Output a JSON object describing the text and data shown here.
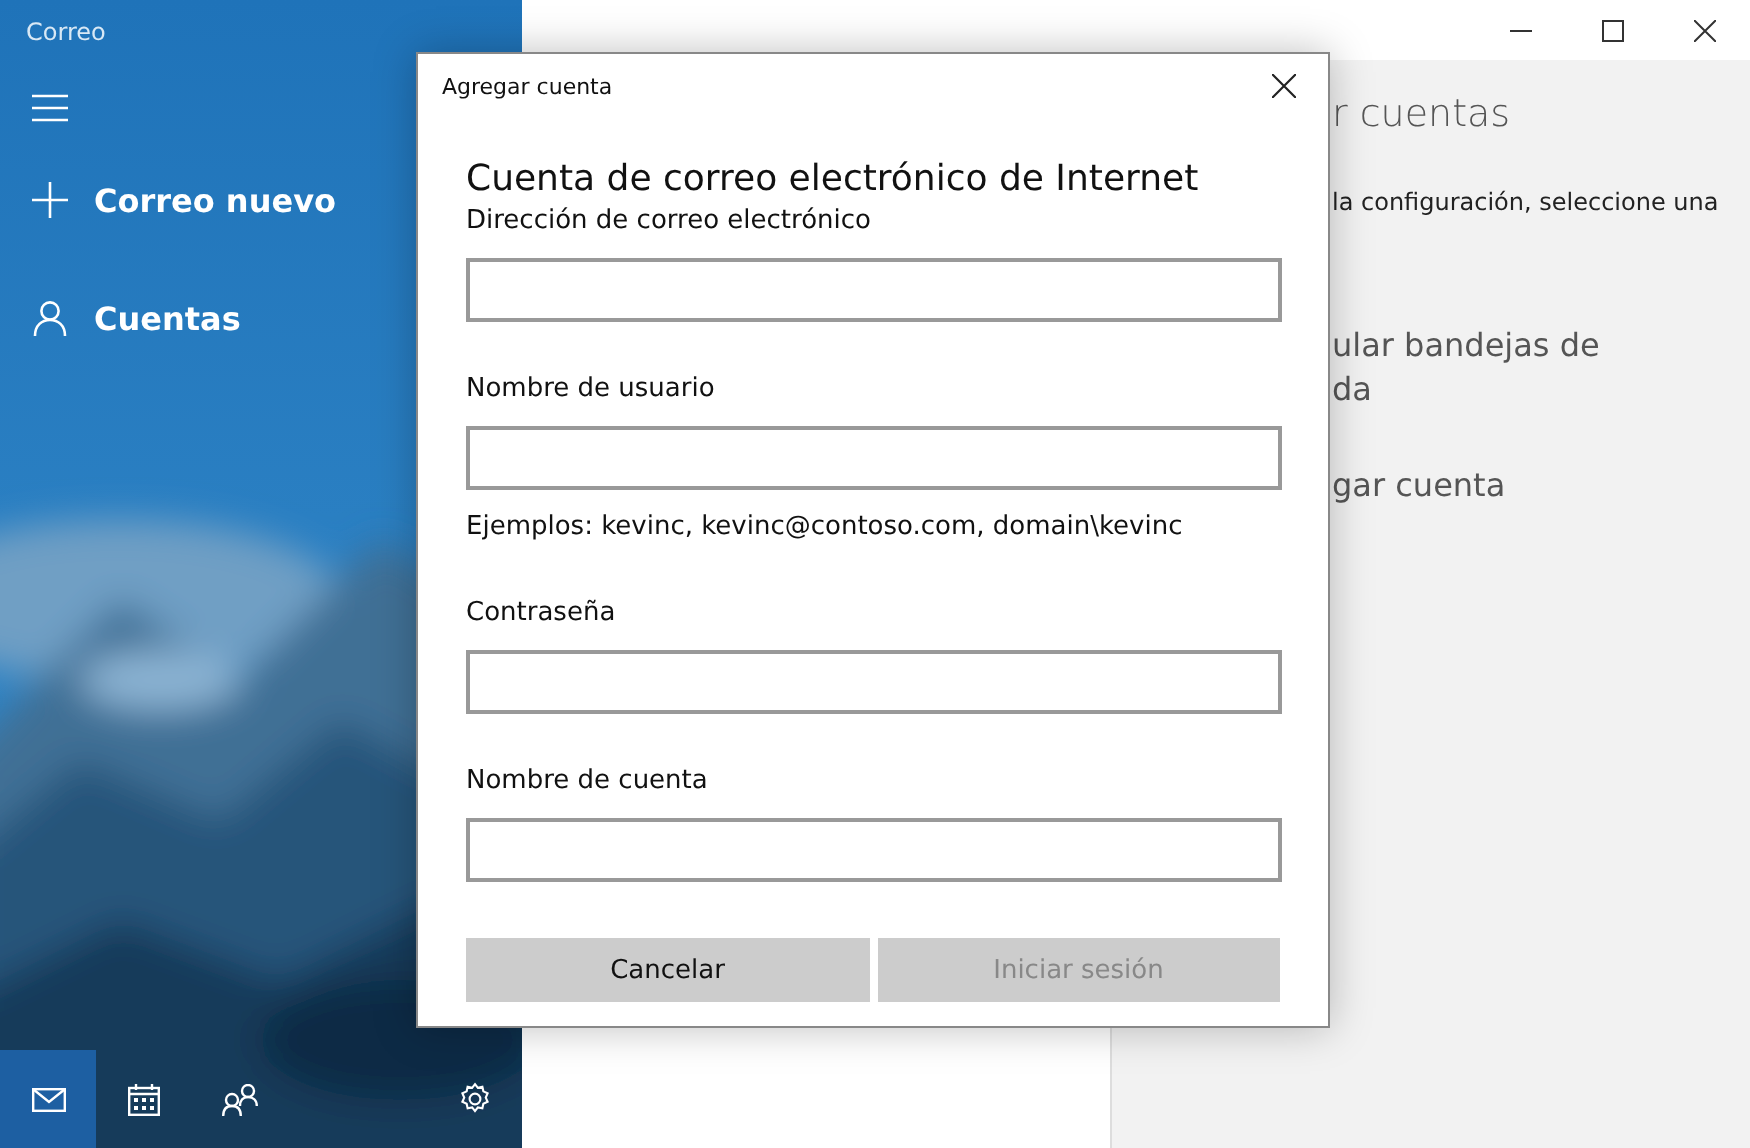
{
  "app": {
    "title": "Correo"
  },
  "nav": [
    {
      "kind": "new",
      "label": "Correo nuevo"
    },
    {
      "kind": "accounts",
      "label": "Cuentas"
    }
  ],
  "bottom_bar": [
    {
      "kind": "mail",
      "selected": true
    },
    {
      "kind": "calendar",
      "selected": false
    },
    {
      "kind": "people",
      "selected": false
    },
    {
      "kind": "settings",
      "selected": false
    }
  ],
  "settings_pane": {
    "title": "r cuentas",
    "description": "la configuración, seleccione una",
    "items": [
      "ular bandejas de\nda",
      "gar cuenta"
    ]
  },
  "dialog": {
    "title": "Agregar cuenta",
    "heading": "Cuenta de correo electrónico de Internet",
    "fields": [
      {
        "label": "Dirección de correo electrónico"
      },
      {
        "label": "Nombre de usuario",
        "hint": "Ejemplos: kevinc, kevinc@contoso.com, domain\\kevinc"
      },
      {
        "label": "Contraseña"
      },
      {
        "label": "Nombre de cuenta"
      }
    ],
    "buttons": [
      {
        "label": "Cancelar",
        "disabled": false
      },
      {
        "label": "Iniciar sesión",
        "disabled": true
      }
    ]
  }
}
